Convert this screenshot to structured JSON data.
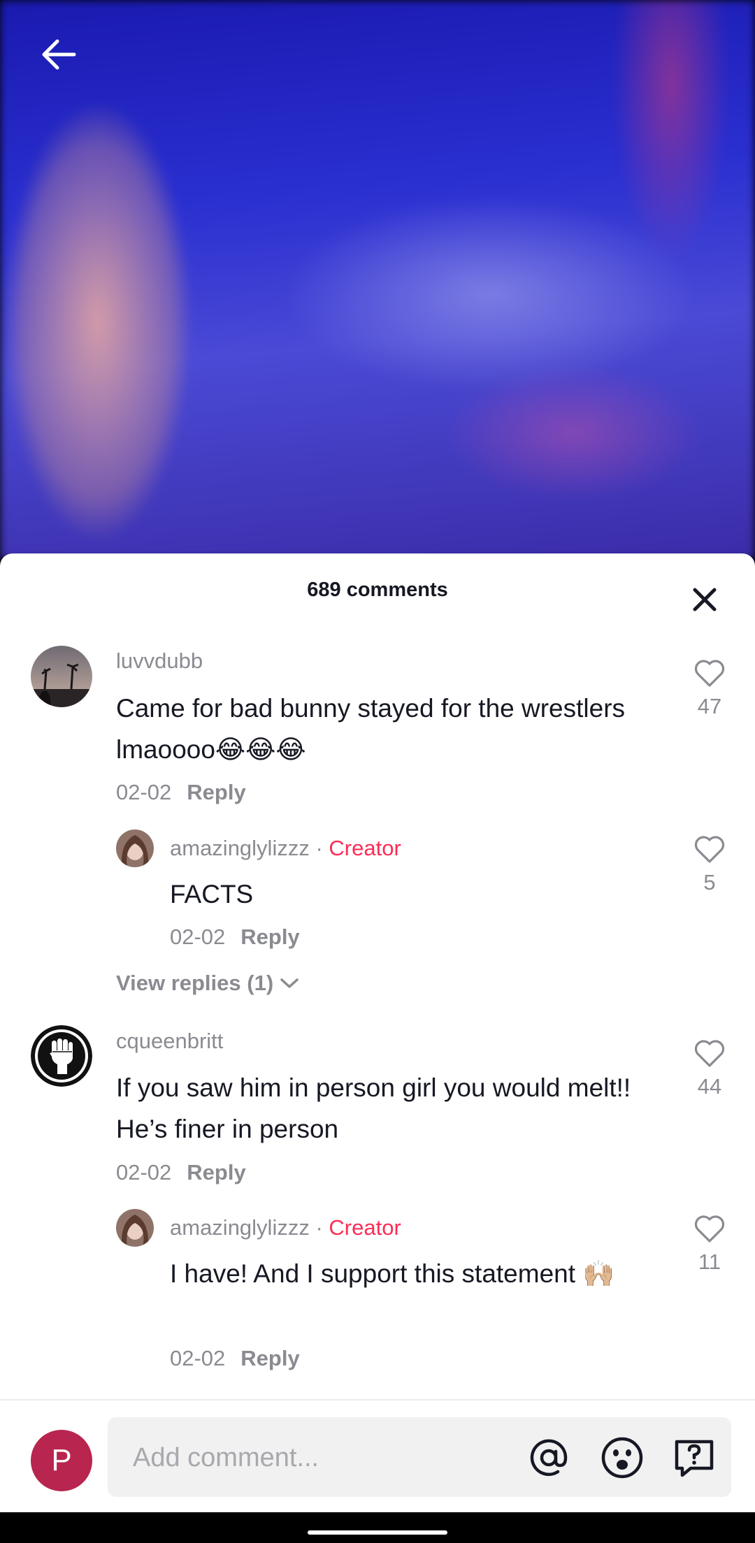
{
  "sheet": {
    "title": "689 comments"
  },
  "comments": [
    {
      "username": "luvvdubb",
      "text": "Came for bad bunny stayed for the wrestlers lmaoooo😂😂😂",
      "date": "02-02",
      "reply_label": "Reply",
      "likes": "47",
      "replies": [
        {
          "username": "amazinglylizzz",
          "separator": "·",
          "badge": "Creator",
          "text": "FACTS",
          "date": "02-02",
          "reply_label": "Reply",
          "likes": "5"
        }
      ],
      "view_replies": "View replies (1)"
    },
    {
      "username": "cqueenbritt",
      "text": "If you saw him in person girl you would melt!! He’s finer in person",
      "date": "02-02",
      "reply_label": "Reply",
      "likes": "44",
      "replies": [
        {
          "username": "amazinglylizzz",
          "separator": "·",
          "badge": "Creator",
          "text": "I have! And I support this statement 🙌🏼",
          "date": "02-02",
          "reply_label": "Reply",
          "likes": "11"
        }
      ]
    }
  ],
  "composer": {
    "avatar_initial": "P",
    "placeholder": "Add comment..."
  },
  "colors": {
    "creator": "#fe2c55",
    "muted": "#8a8b91",
    "text": "#161823",
    "composer_avatar": "#b8254f"
  }
}
